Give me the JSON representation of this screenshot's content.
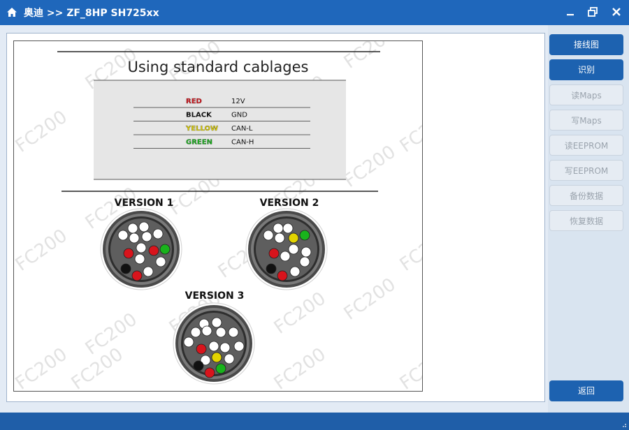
{
  "titlebar": {
    "title": "奥迪 >> ZF_8HP SH725xx",
    "icon": "home-icon"
  },
  "figure": {
    "heading": "Using  standard cablages",
    "cable_table": [
      {
        "color_name": "RED",
        "signal": "12V",
        "color": "#d8141c"
      },
      {
        "color_name": "BLACK",
        "signal": "GND",
        "color": "#111111"
      },
      {
        "color_name": "YELLOW",
        "signal": "CAN-L",
        "color": "#e3d400"
      },
      {
        "color_name": "GREEN",
        "signal": "CAN-H",
        "color": "#19b31c"
      }
    ],
    "versions": {
      "v1": "VERSION 1",
      "v2": "VERSION 2",
      "v3": "VERSION 3"
    },
    "watermark": "FC200"
  },
  "sidebar": {
    "buttons": [
      {
        "label": "接线图",
        "state": "active"
      },
      {
        "label": "识别",
        "state": "active"
      },
      {
        "label": "读Maps",
        "state": "disabled"
      },
      {
        "label": "写Maps",
        "state": "disabled"
      },
      {
        "label": "读EEPROM",
        "state": "disabled"
      },
      {
        "label": "写EEPROM",
        "state": "disabled"
      },
      {
        "label": "备份数据",
        "state": "disabled"
      },
      {
        "label": "恢复数据",
        "state": "disabled"
      }
    ],
    "back_label": "返回"
  },
  "colors": {
    "titlebar": "#1f67bb",
    "button_active": "#1d62b0",
    "pin_red": "#d8141c",
    "pin_yellow": "#e3d400",
    "pin_green": "#19b31c",
    "pin_black": "#111111"
  }
}
